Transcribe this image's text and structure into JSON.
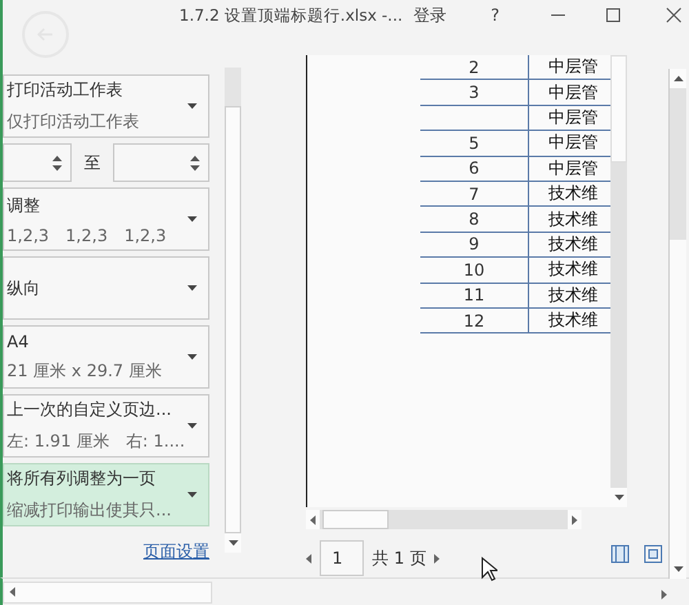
{
  "window": {
    "title": "1.7.2 设置顶端标题行.xlsx -...",
    "sign_in": "登录",
    "help": "?"
  },
  "settings": [
    {
      "kind": "dropdown",
      "title": "打印活动工作表",
      "details": [
        "仅打印活动工作表"
      ],
      "selected": false
    },
    {
      "kind": "pages",
      "separator": "至"
    },
    {
      "kind": "dropdown",
      "title": "调整",
      "details": [
        "1,2,3",
        "1,2,3",
        "1,2,3"
      ],
      "selected": false
    },
    {
      "kind": "dropdown",
      "title": "纵向",
      "selected": false
    },
    {
      "kind": "dropdown",
      "title": "A4",
      "details": [
        "21 厘米 x 29.7 厘米"
      ],
      "selected": false
    },
    {
      "kind": "dropdown",
      "title": "上一次的自定义页边...",
      "details": [
        "左: 1.91 厘米",
        "右: 1...."
      ],
      "selected": false
    },
    {
      "kind": "dropdown",
      "title": "将所有列调整为一页",
      "details": [
        "缩减打印输出使其只..."
      ],
      "selected": true
    }
  ],
  "page_setup_link": "页面设置",
  "preview": {
    "rows": [
      {
        "number": "2",
        "text": "中层管"
      },
      {
        "number": "3",
        "text": "中层管"
      },
      {
        "number": "",
        "text": "中层管"
      },
      {
        "number": "5",
        "text": "中层管"
      },
      {
        "number": "6",
        "text": "中层管"
      },
      {
        "number": "7",
        "text": "技术维"
      },
      {
        "number": "8",
        "text": "技术维"
      },
      {
        "number": "9",
        "text": "技术维"
      },
      {
        "number": "10",
        "text": "技术维"
      },
      {
        "number": "11",
        "text": "技术维"
      },
      {
        "number": "12",
        "text": "技术维"
      }
    ]
  },
  "nav": {
    "page": "1",
    "total": "共 1 页"
  }
}
